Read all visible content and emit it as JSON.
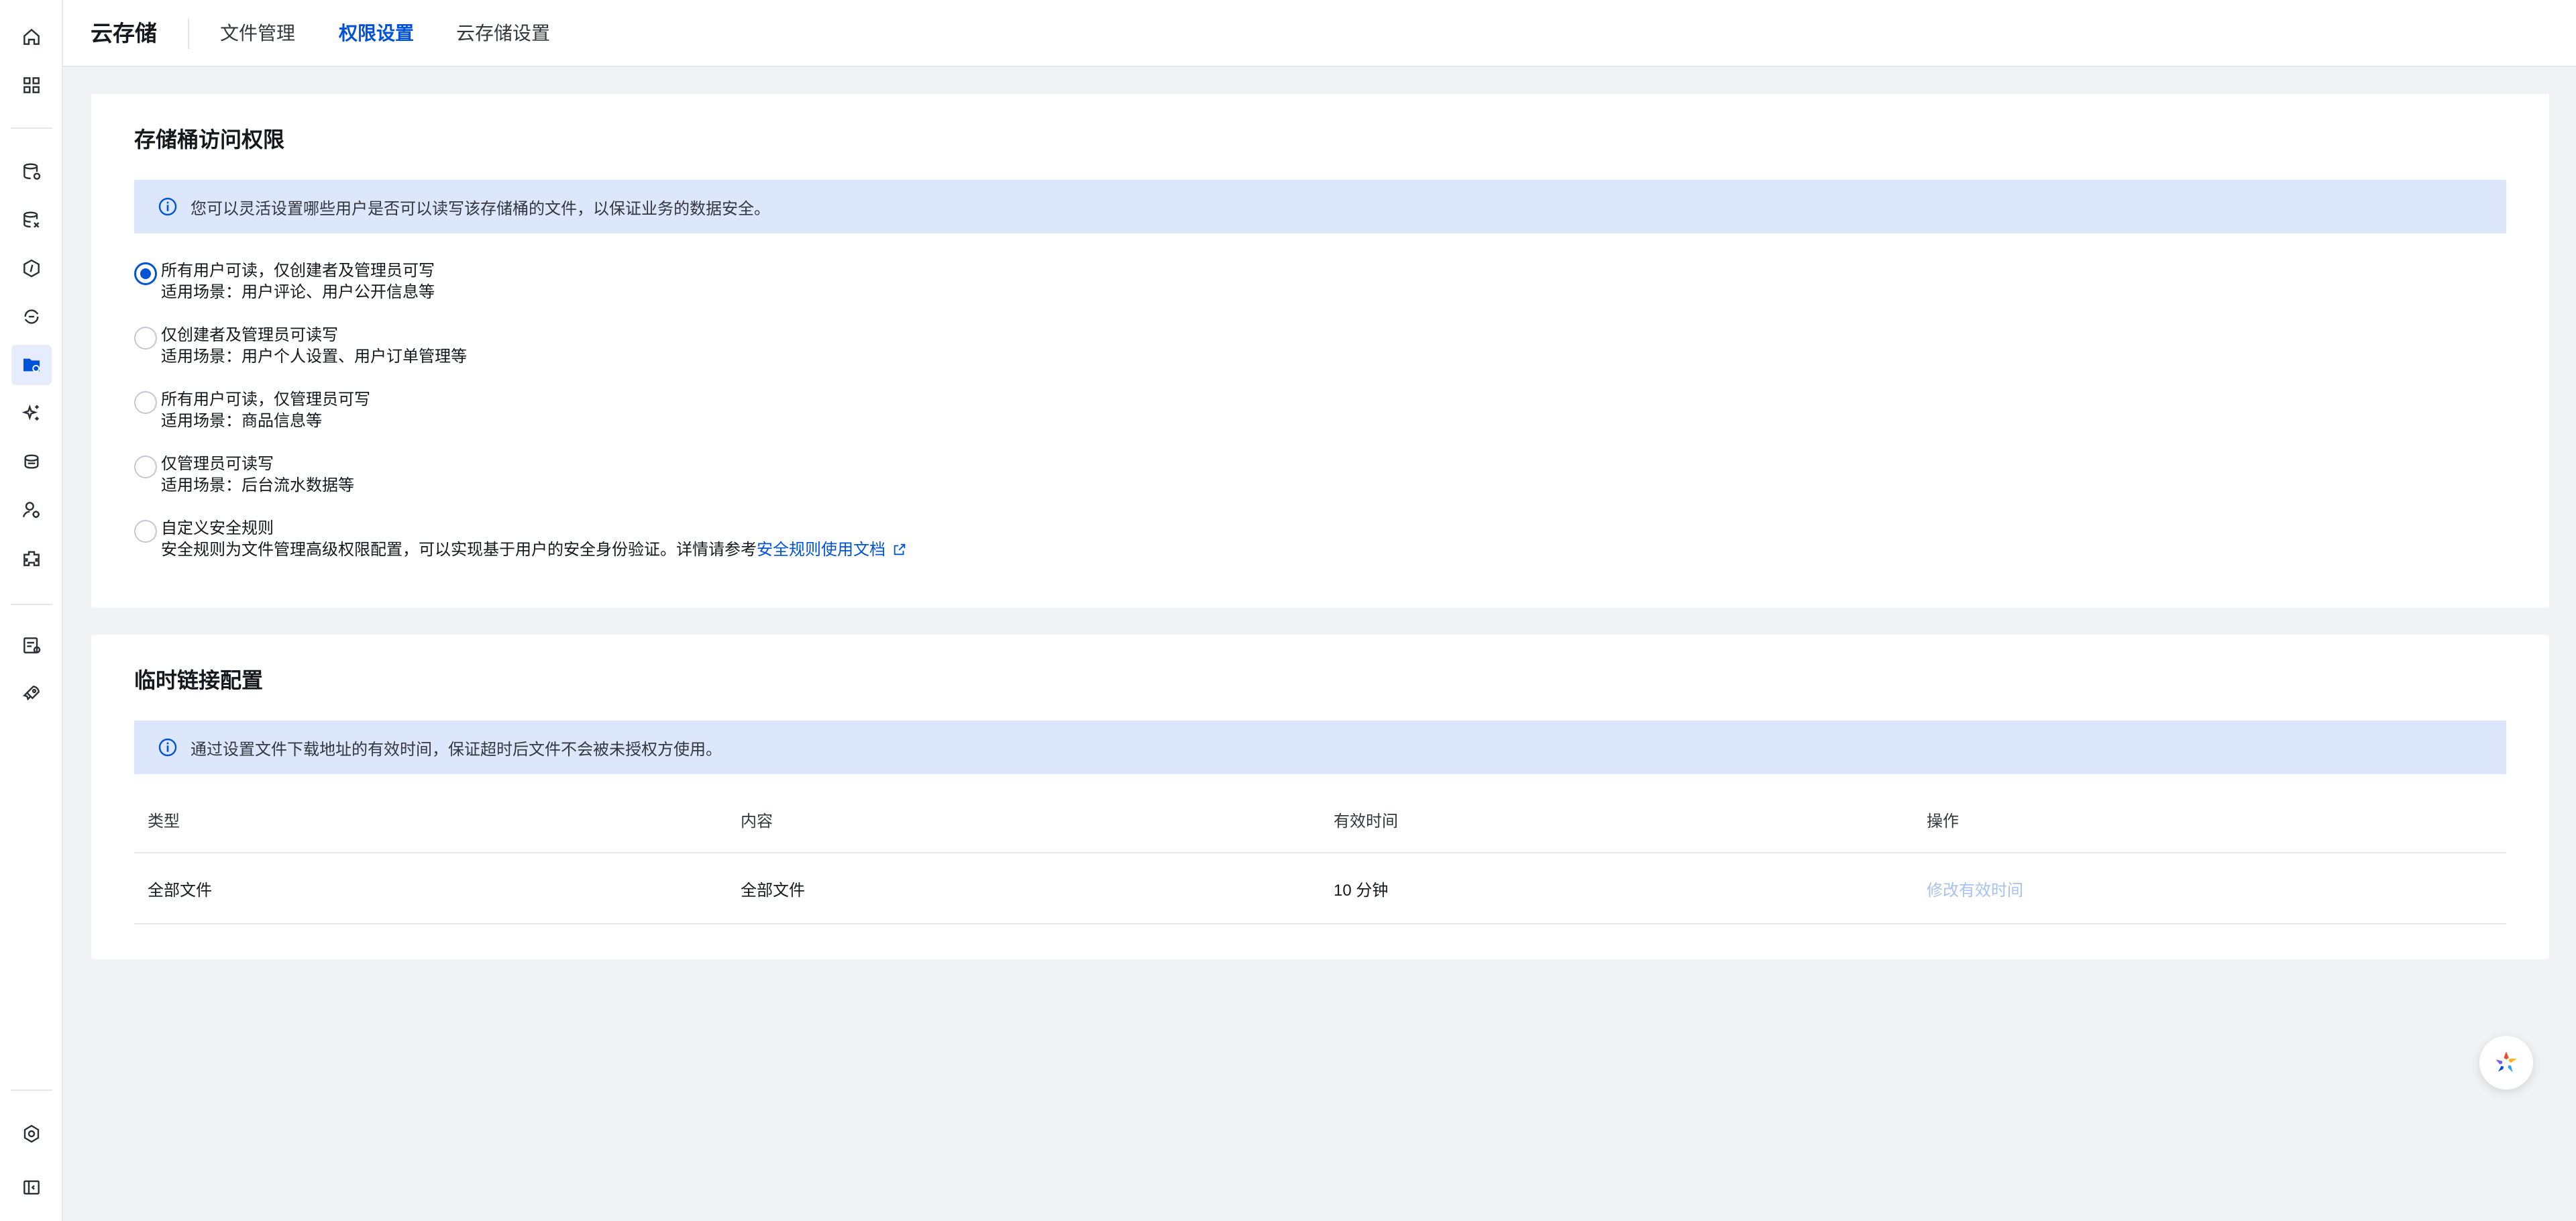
{
  "app": {
    "title": "云存储"
  },
  "tabs": [
    {
      "label": "文件管理",
      "active": false
    },
    {
      "label": "权限设置",
      "active": true
    },
    {
      "label": "云存储设置",
      "active": false
    }
  ],
  "sidebar": {
    "icons": [
      "home-icon",
      "dashboard-icon",
      "database-icon",
      "database-settings-icon",
      "function-icon",
      "sync-icon",
      "storage-folder-icon",
      "ai-sparkle-icon",
      "static-hosting-icon",
      "user-auth-icon",
      "extension-icon",
      "log-icon",
      "deploy-icon",
      "settings-icon",
      "collapse-sidebar-icon"
    ],
    "active": "storage-folder-icon"
  },
  "bucket_access": {
    "title": "存储桶访问权限",
    "notice": "您可以灵活设置哪些用户是否可以读写该存储桶的文件，以保证业务的数据安全。",
    "options": [
      {
        "title": "所有用户可读，仅创建者及管理员可写",
        "desc": "适用场景：用户评论、用户公开信息等",
        "checked": true
      },
      {
        "title": "仅创建者及管理员可读写",
        "desc": "适用场景：用户个人设置、用户订单管理等",
        "checked": false
      },
      {
        "title": "所有用户可读，仅管理员可写",
        "desc": "适用场景：商品信息等",
        "checked": false
      },
      {
        "title": "仅管理员可读写",
        "desc": "适用场景：后台流水数据等",
        "checked": false
      },
      {
        "title": "自定义安全规则",
        "desc": "安全规则为文件管理高级权限配置，可以实现基于用户的安全身份验证。详情请参考",
        "link": "安全规则使用文档",
        "checked": false
      }
    ]
  },
  "temp_link": {
    "title": "临时链接配置",
    "notice": "通过设置文件下载地址的有效时间，保证超时后文件不会被未授权方使用。",
    "columns": [
      "类型",
      "内容",
      "有效时间",
      "操作"
    ],
    "rows": [
      {
        "type": "全部文件",
        "content": "全部文件",
        "duration": "10 分钟",
        "action": "修改有效时间"
      }
    ]
  },
  "colors": {
    "accent": "#0052d9",
    "notice_bg": "#dde7fb",
    "page_bg": "#f1f2f6"
  }
}
